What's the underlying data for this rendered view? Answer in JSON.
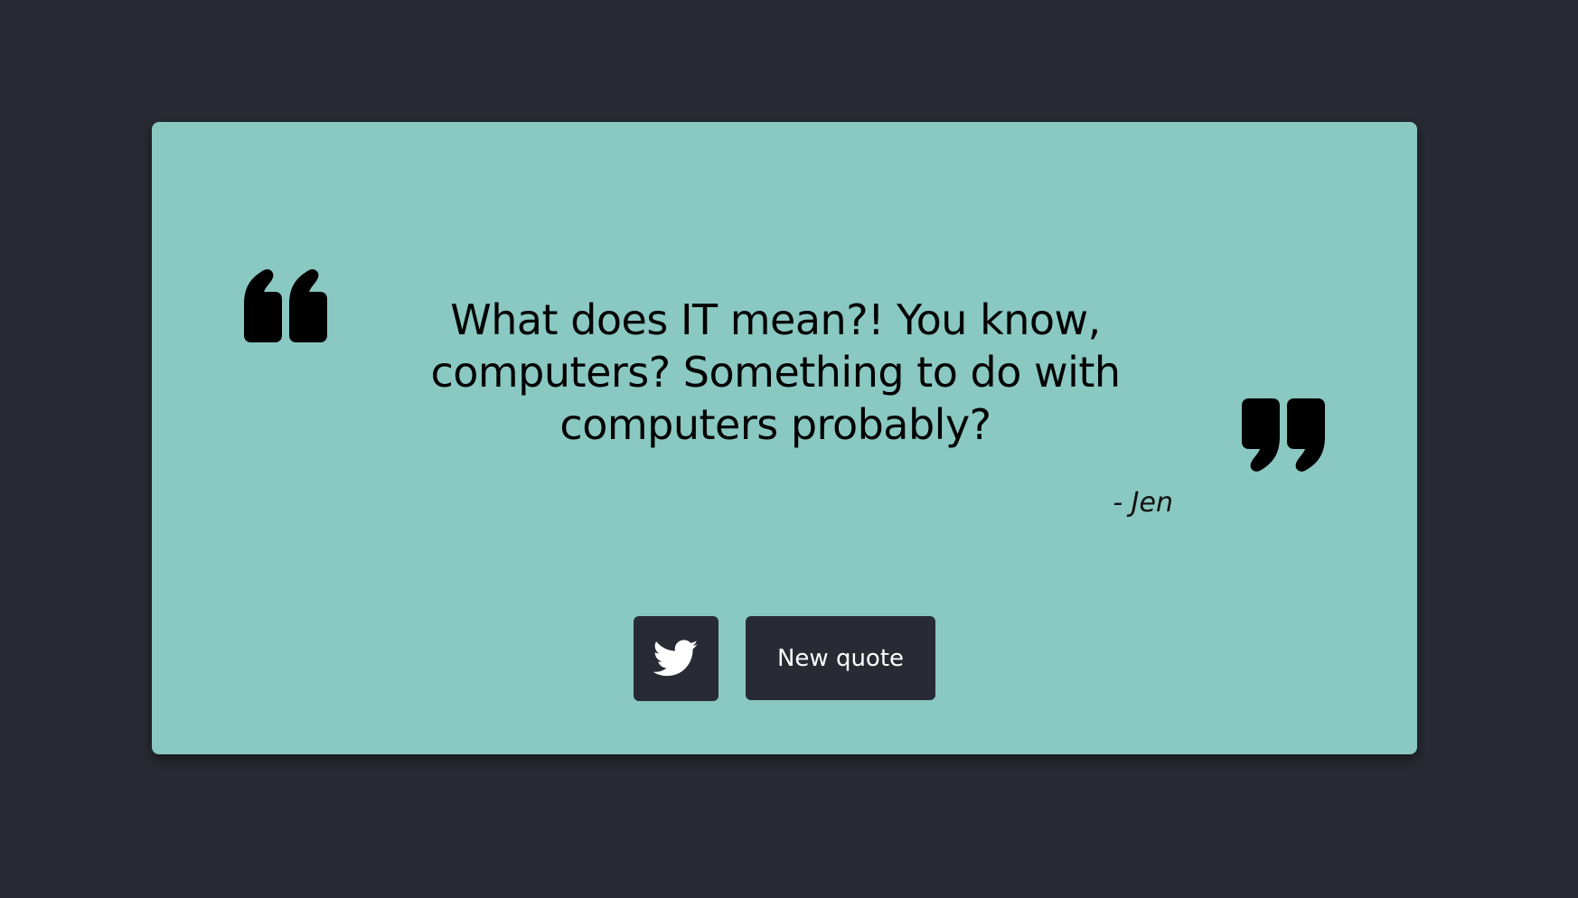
{
  "quote": {
    "text": "What does IT mean?! You know, computers? Something to do with computers probably?",
    "author": "- Jen"
  },
  "buttons": {
    "tweet_icon": "twitter-icon",
    "new_quote_label": "New quote"
  },
  "icons": {
    "open": "quote-open-icon",
    "close": "quote-close-icon"
  },
  "colors": {
    "background": "#282b33",
    "card": "#8ac8c2",
    "button": "#282b33",
    "button_text": "#ffffff",
    "text": "#000000"
  }
}
